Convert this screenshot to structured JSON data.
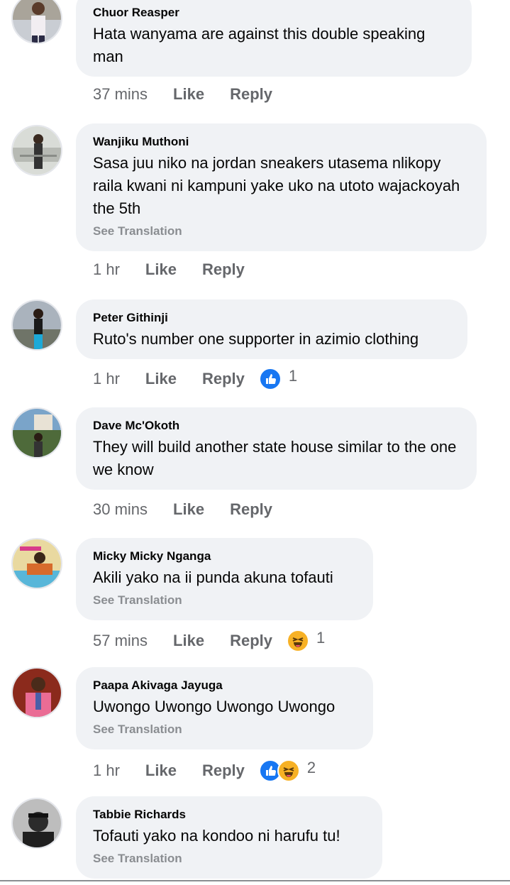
{
  "comments": [
    {
      "author": "Chuor Reasper",
      "text": "Hata wanyama are against this double speaking man",
      "time": "37 mins",
      "like_label": "Like",
      "reply_label": "Reply"
    },
    {
      "author": "Wanjiku Muthoni",
      "text": "Sasa juu niko na jordan sneakers utasema nlikopy raila kwani  ni kampuni yake uko na utoto wajackoyah the 5th",
      "see_translation": "See Translation",
      "time": "1 hr",
      "like_label": "Like",
      "reply_label": "Reply"
    },
    {
      "author": "Peter Githinji",
      "text": "Ruto's number one supporter in azimio clothing",
      "time": "1 hr",
      "like_label": "Like",
      "reply_label": "Reply",
      "reactions": [
        "like-icon"
      ],
      "reaction_count": "1"
    },
    {
      "author": "Dave Mc'Okoth",
      "text": "They will build another state house similar to the one we know",
      "time": "30 mins",
      "like_label": "Like",
      "reply_label": "Reply"
    },
    {
      "author": "Micky Micky Nganga",
      "text": "Akili yako na ii punda akuna tofauti",
      "see_translation": "See Translation",
      "time": "57 mins",
      "like_label": "Like",
      "reply_label": "Reply",
      "reactions": [
        "haha-icon"
      ],
      "reaction_count": "1"
    },
    {
      "author": "Paapa Akivaga Jayuga",
      "text": "Uwongo Uwongo Uwongo Uwongo",
      "see_translation": "See Translation",
      "time": "1 hr",
      "like_label": "Like",
      "reply_label": "Reply",
      "reactions": [
        "like-icon",
        "haha-icon"
      ],
      "reaction_count": "2"
    },
    {
      "author": "Tabbie Richards",
      "text": "Tofauti yako na kondoo ni harufu tu!",
      "see_translation": "See Translation"
    }
  ],
  "colors": {
    "bubble": "#f0f2f5",
    "meta_text": "#65676b",
    "like_blue": "#1877f2",
    "haha_yellow": "#f7b125"
  }
}
